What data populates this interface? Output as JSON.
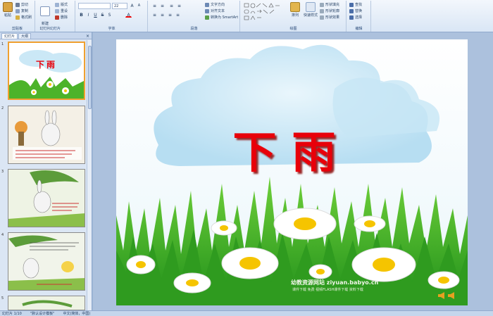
{
  "ribbon": {
    "clipboard": {
      "label": "剪贴板",
      "paste": "粘贴",
      "cut": "剪切",
      "copy": "复制",
      "format_painter": "格式刷"
    },
    "slides": {
      "label": "幻灯片",
      "new_slide": "新建\n幻灯片",
      "layout": "版式",
      "reset": "重设",
      "delete": "删除"
    },
    "font": {
      "label": "字体",
      "size": "22"
    },
    "paragraph": {
      "label": "段落",
      "text_direction": "文字方向",
      "align_text": "对齐文本",
      "smartart": "转换为 SmartArt"
    },
    "drawing": {
      "label": "绘图",
      "arrange": "排列",
      "quick_styles": "快速样式",
      "shape_fill": "形状填充",
      "shape_outline": "形状轮廓",
      "shape_effects": "形状效果"
    },
    "editing": {
      "label": "编辑",
      "find": "查找",
      "replace": "替换",
      "select": "选择"
    }
  },
  "panel": {
    "tab_slides": "幻灯片",
    "tab_outline": "大纲",
    "thumbs": [
      {
        "num": "1",
        "title": "下雨"
      },
      {
        "num": "2"
      },
      {
        "num": "3"
      },
      {
        "num": "4"
      },
      {
        "num": "5"
      }
    ]
  },
  "slide": {
    "title": "下雨",
    "watermark_line1": "幼教资源网站 ziyuan.babyo.cn",
    "watermark_line2": "课件下载  免费  视频FLASH课件下载  资料下载"
  },
  "status": {
    "slide_info": "幻灯片 1/10",
    "theme": "\"默认设计模板\"",
    "language": "中文(简体，中国)"
  },
  "colors": {
    "title_red": "#e8000a",
    "grass": "#3fa61f",
    "sky": "#bfe3f5"
  }
}
